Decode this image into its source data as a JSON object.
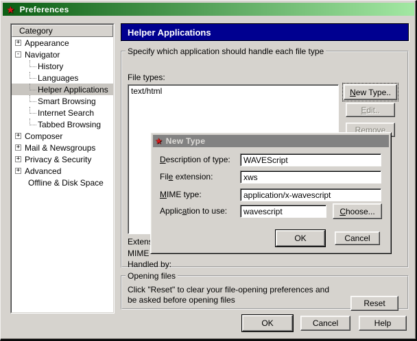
{
  "colors": {
    "titlebar_start": "#0b5e13",
    "titlebar_end": "#a3e8a3",
    "header_bg": "#000090",
    "body_bg": "#d6d3ce",
    "selection_bg": "#c8c5c0"
  },
  "window": {
    "title": "Preferences",
    "icon": "red-star",
    "icon_glyph": "★"
  },
  "sidebar": {
    "header": "Category",
    "items": [
      {
        "label": "Appearance",
        "expander": "+"
      },
      {
        "label": "Navigator",
        "expander": "-"
      },
      {
        "label": "History",
        "level": 1
      },
      {
        "label": "Languages",
        "level": 1
      },
      {
        "label": "Helper Applications",
        "level": 1,
        "selected": true
      },
      {
        "label": "Smart Browsing",
        "level": 1
      },
      {
        "label": "Internet Search",
        "level": 1
      },
      {
        "label": "Tabbed Browsing",
        "level": 1
      },
      {
        "label": "Composer",
        "expander": "+"
      },
      {
        "label": "Mail & Newsgroups",
        "expander": "+"
      },
      {
        "label": "Privacy & Security",
        "expander": "+"
      },
      {
        "label": "Advanced",
        "expander": "+"
      },
      {
        "label": "Offline & Disk Space"
      }
    ]
  },
  "main": {
    "title": "Helper Applications",
    "filetypes_group": {
      "legend": "Specify which application should handle each file type",
      "file_types_label": "File types:",
      "list_items": [
        "text/html"
      ],
      "buttons": {
        "new_type": {
          "pre": "",
          "key": "N",
          "post": "ew Type.."
        },
        "edit": {
          "pre": "",
          "key": "E",
          "post": "dit.."
        },
        "remove": {
          "pre": "",
          "key": "R",
          "post": "emove"
        }
      },
      "detail_labels": [
        "Extens",
        "MIME",
        "Handled by:"
      ]
    },
    "opening_group": {
      "legend": "Opening files",
      "lines": [
        "Click \"Reset\" to clear your file-opening preferences and",
        "be asked before opening files"
      ],
      "reset_label": "Reset"
    },
    "footer_buttons": {
      "ok": "OK",
      "cancel": "Cancel",
      "help": "Help"
    }
  },
  "dialog": {
    "title": "New Type",
    "icon": "red-star",
    "icon_glyph": "★",
    "fields": [
      {
        "label": {
          "pre": "",
          "key": "D",
          "post": "escription of type:"
        },
        "value": "WAVEScript"
      },
      {
        "label": {
          "pre": "Fil",
          "key": "e",
          "post": " extension:"
        },
        "value": "xws"
      },
      {
        "label": {
          "pre": "",
          "key": "M",
          "post": "IME type:"
        },
        "value": "application/x-wavescript"
      },
      {
        "label": {
          "pre": "Applic",
          "key": "a",
          "post": "tion to use:"
        },
        "value": "wavescript"
      }
    ],
    "choose_label": {
      "pre": "",
      "key": "C",
      "post": "hoose..."
    },
    "ok_label": "OK",
    "cancel_label": "Cancel"
  }
}
